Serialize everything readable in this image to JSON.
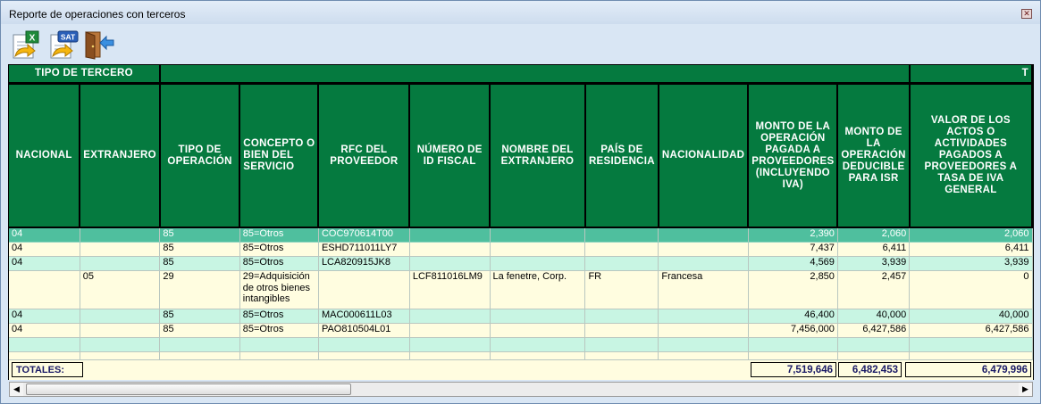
{
  "window": {
    "title": "Reporte de operaciones con terceros",
    "close_glyph": "✕"
  },
  "toolbar": {
    "buttons": [
      {
        "name": "export-excel-button",
        "icon": "excel-export-icon"
      },
      {
        "name": "sat-export-button",
        "icon": "sat-export-icon",
        "badge": "SAT"
      },
      {
        "name": "exit-button",
        "icon": "exit-door-icon"
      }
    ]
  },
  "grid": {
    "group_header": {
      "tipo_tercero": "TIPO DE TERCERO",
      "partial": "T"
    },
    "columns": [
      "NACIONAL",
      "EXTRANJERO",
      "TIPO DE OPERACIÓN",
      "CONCEPTO O BIEN DEL SERVICIO",
      "RFC DEL PROVEEDOR",
      "NÚMERO DE ID FISCAL",
      "NOMBRE DEL EXTRANJERO",
      "PAÍS DE RESIDENCIA",
      "NACIONALIDAD",
      "MONTO DE LA OPERACIÓN PAGADA A PROVEEDORES (INCLUYENDO IVA)",
      "MONTO DE LA OPERACIÓN DEDUCIBLE PARA ISR",
      "VALOR DE LOS ACTOS O ACTIVIDADES PAGADOS A PROVEEDORES A TASA DE IVA GENERAL"
    ],
    "rows": [
      [
        "04",
        "",
        "85",
        "85=Otros",
        "COC970614T00",
        "",
        "",
        "",
        "",
        "2,390",
        "2,060",
        "2,060"
      ],
      [
        "04",
        "",
        "85",
        "85=Otros",
        "ESHD711011LY7",
        "",
        "",
        "",
        "",
        "7,437",
        "6,411",
        "6,411"
      ],
      [
        "04",
        "",
        "85",
        "85=Otros",
        "LCA820915JK8",
        "",
        "",
        "",
        "",
        "4,569",
        "3,939",
        "3,939"
      ],
      [
        "",
        "05",
        "29",
        "29=Adquisición de otros bienes intangibles",
        "",
        "LCF811016LM9",
        "La fenetre, Corp.",
        "FR",
        "Francesa",
        "2,850",
        "2,457",
        "0"
      ],
      [
        "04",
        "",
        "85",
        "85=Otros",
        "MAC000611L03",
        "",
        "",
        "",
        "",
        "46,400",
        "40,000",
        "40,000"
      ],
      [
        "04",
        "",
        "85",
        "85=Otros",
        "PAO810504L01",
        "",
        "",
        "",
        "",
        "7,456,000",
        "6,427,586",
        "6,427,586"
      ]
    ],
    "selected_row": 0
  },
  "totals": {
    "label": "TOTALES:",
    "monto_pagado": "7,519,646",
    "monto_deducible": "6,482,453",
    "valor_actos": "6,479,996"
  },
  "scrollbar": {
    "left_arrow": "◀",
    "right_arrow": "▶"
  }
}
